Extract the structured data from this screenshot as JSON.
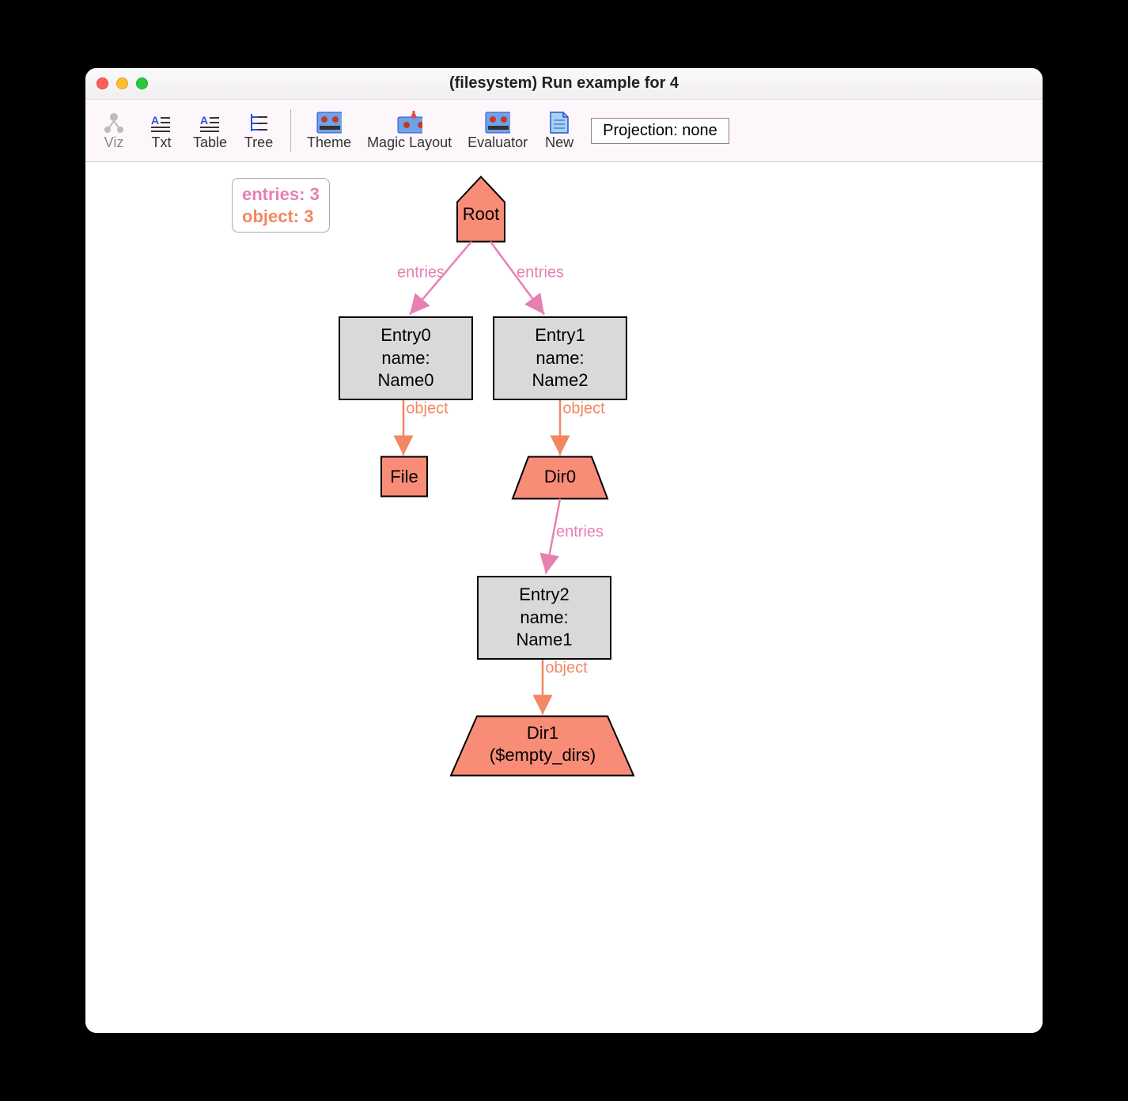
{
  "window": {
    "title": "(filesystem) Run example for 4"
  },
  "toolbar": {
    "viz": "Viz",
    "txt": "Txt",
    "table": "Table",
    "tree": "Tree",
    "theme": "Theme",
    "magic_layout": "Magic Layout",
    "evaluator": "Evaluator",
    "new": "New",
    "projection": "Projection: none"
  },
  "legend": {
    "entries_label": "entries: 3",
    "object_label": "object: 3"
  },
  "nodes": {
    "root": "Root",
    "entry0_l1": "Entry0",
    "entry0_l2": "name: Name0",
    "entry1_l1": "Entry1",
    "entry1_l2": "name: Name2",
    "file": "File",
    "dir0": "Dir0",
    "entry2_l1": "Entry2",
    "entry2_l2": "name: Name1",
    "dir1_l1": "Dir1",
    "dir1_l2": "($empty_dirs)"
  },
  "edges": {
    "entries": "entries",
    "object": "object"
  },
  "colors": {
    "reddish": "#f88c77",
    "grey": "#d9d9d9",
    "pink": "#e77fb3",
    "orange": "#f28762"
  }
}
